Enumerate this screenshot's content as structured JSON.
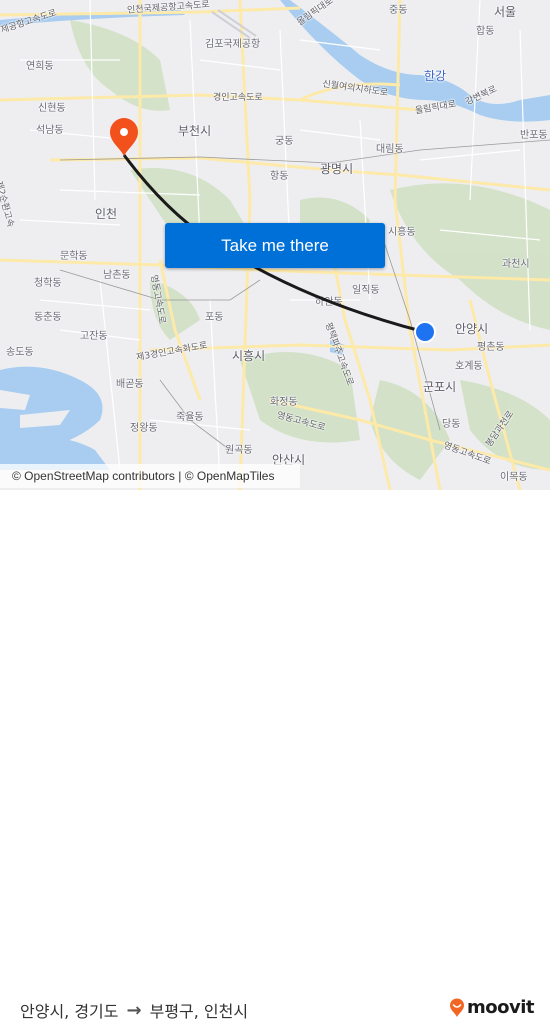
{
  "map": {
    "labels": [
      {
        "id": "incheon-airport-expressway-a",
        "text": "인천국제공항고속도로",
        "kind": "road"
      },
      {
        "id": "incheon-airport-expressway-b",
        "text": "제공항고속도로",
        "kind": "road"
      },
      {
        "id": "gimpo-airport",
        "text": "김포국제공항",
        "kind": "place"
      },
      {
        "id": "yeonhui-dong",
        "text": "연희동",
        "kind": "place"
      },
      {
        "id": "gyeongin-expressway",
        "text": "경인고속도로",
        "kind": "road"
      },
      {
        "id": "sinhyeon-dong",
        "text": "신현동",
        "kind": "place"
      },
      {
        "id": "seonam-dong",
        "text": "석남동",
        "kind": "place"
      },
      {
        "id": "bucheon-si",
        "text": "부천시",
        "kind": "city"
      },
      {
        "id": "incheon",
        "text": "인천",
        "kind": "city"
      },
      {
        "id": "second-ring-expressway",
        "text": "제2순환고속",
        "kind": "road"
      },
      {
        "id": "jung-dong",
        "text": "중동",
        "kind": "place"
      },
      {
        "id": "seoul",
        "text": "서울",
        "kind": "city"
      },
      {
        "id": "hap-dong",
        "text": "합동",
        "kind": "place"
      },
      {
        "id": "olympic-daero-north",
        "text": "올림픽대로",
        "kind": "road"
      },
      {
        "id": "hangang",
        "text": "한강",
        "kind": "water"
      },
      {
        "id": "sinwol-yeoui-tunnel",
        "text": "신월여의지하도로",
        "kind": "road"
      },
      {
        "id": "gangbyeon-buk-ro",
        "text": "강변북로",
        "kind": "road"
      },
      {
        "id": "olympic-daero",
        "text": "올림픽대로",
        "kind": "road"
      },
      {
        "id": "banpo-dong",
        "text": "반포동",
        "kind": "place"
      },
      {
        "id": "gung-dong",
        "text": "궁동",
        "kind": "place"
      },
      {
        "id": "daerim-dong",
        "text": "대림동",
        "kind": "place"
      },
      {
        "id": "gwangmyeong-si",
        "text": "광명시",
        "kind": "city"
      },
      {
        "id": "hang-dong",
        "text": "항동",
        "kind": "place"
      },
      {
        "id": "siheung-dong",
        "text": "시흥동",
        "kind": "place"
      },
      {
        "id": "munhak-dong",
        "text": "문학동",
        "kind": "place"
      },
      {
        "id": "namchon-dong",
        "text": "남촌동",
        "kind": "place"
      },
      {
        "id": "cheonghak-dong",
        "text": "청학동",
        "kind": "place"
      },
      {
        "id": "yeongdong-expressway-v",
        "text": "영동고속도로",
        "kind": "road"
      },
      {
        "id": "dongchun-dong",
        "text": "동춘동",
        "kind": "place"
      },
      {
        "id": "po-dong",
        "text": "포동",
        "kind": "place"
      },
      {
        "id": "gojan-dong",
        "text": "고잔동",
        "kind": "place"
      },
      {
        "id": "songdo-dong",
        "text": "송도동",
        "kind": "place"
      },
      {
        "id": "third-gyeongin-expressway",
        "text": "제3경인고속화도로",
        "kind": "road"
      },
      {
        "id": "siheung-si",
        "text": "시흥시",
        "kind": "city"
      },
      {
        "id": "gwacheon-si",
        "text": "과천시",
        "kind": "city"
      },
      {
        "id": "iljik-dong",
        "text": "일직동",
        "kind": "place"
      },
      {
        "id": "haan-dong",
        "text": "하안동",
        "kind": "place"
      },
      {
        "id": "pyeongtaek-paju-expressway",
        "text": "평택파주고속도로",
        "kind": "road"
      },
      {
        "id": "anyang-si",
        "text": "안양시",
        "kind": "city"
      },
      {
        "id": "pyeongchon-dong",
        "text": "평촌동",
        "kind": "place"
      },
      {
        "id": "hogye-dong",
        "text": "호계동",
        "kind": "place"
      },
      {
        "id": "gunpo-si",
        "text": "군포시",
        "kind": "city"
      },
      {
        "id": "baegot-dong",
        "text": "배곧동",
        "kind": "place"
      },
      {
        "id": "jugyul-dong",
        "text": "죽율동",
        "kind": "place"
      },
      {
        "id": "jeongwang-dong",
        "text": "정왕동",
        "kind": "place"
      },
      {
        "id": "hwajeong-dong",
        "text": "화정동",
        "kind": "place"
      },
      {
        "id": "yeongdong-expressway",
        "text": "영동고속도로",
        "kind": "road"
      },
      {
        "id": "yeongdong-expressway-east",
        "text": "영동고속도로",
        "kind": "road"
      },
      {
        "id": "wongok-dong",
        "text": "원곡동",
        "kind": "place"
      },
      {
        "id": "ansan-si",
        "text": "안산시",
        "kind": "city"
      },
      {
        "id": "dang-dong",
        "text": "당동",
        "kind": "place"
      },
      {
        "id": "imok-dong",
        "text": "이목동",
        "kind": "place"
      },
      {
        "id": "bongdam-expressway",
        "text": "봉담과천로",
        "kind": "road"
      }
    ],
    "origin_marker": "blue-dot",
    "destination_marker": "orange-pin"
  },
  "cta": {
    "label": "Take me there"
  },
  "attribution": "© OpenStreetMap contributors | © OpenMapTiles",
  "footer": {
    "origin": "안양시, 경기도",
    "arrow": "→",
    "destination": "부평구, 인천시",
    "brand": "moovit"
  },
  "colors": {
    "cta": "#0070d9",
    "destination_pin": "#f2511b",
    "origin_dot": "#1e74f0",
    "route_line": "#1a1a1a",
    "brand_accent": "#f26522"
  }
}
